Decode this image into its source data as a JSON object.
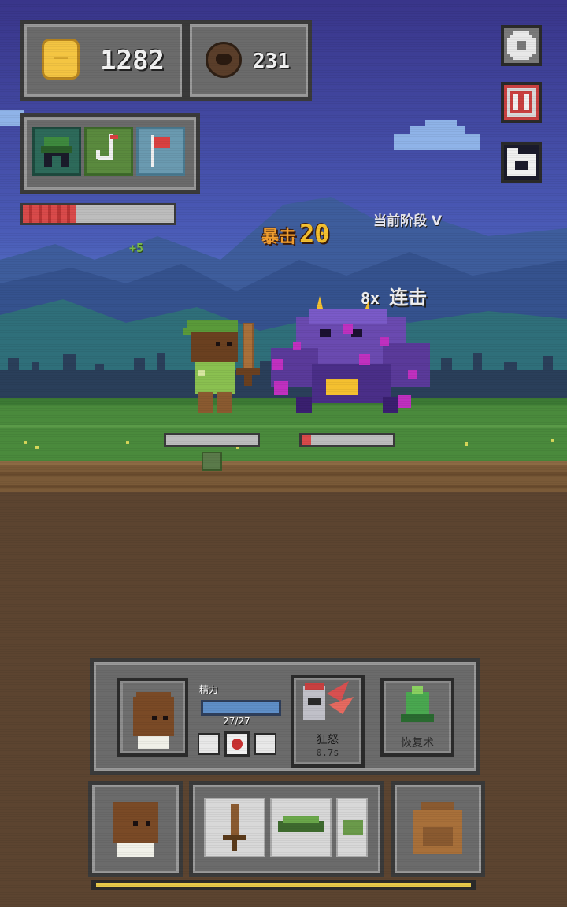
{
  "hud": {
    "gold": "1282",
    "gems": "231",
    "stage_label": "当前阶段 V",
    "plus_label": "+5"
  },
  "combat": {
    "crit_label": "暴击",
    "crit_value": "20",
    "combo_count": "8x",
    "combo_label": "连击",
    "player_hp_fraction": 0.0,
    "enemy_hp_fraction": 0.1,
    "player_main_hp_fraction": 0.35
  },
  "skills_panel": {
    "stamina_label": "精力",
    "stamina_value": "27/27",
    "rage_label": "狂怒",
    "rage_cooldown": "0.7s",
    "heal_label": "恢复术"
  },
  "colors": {
    "sky_top": "#3a3a8a",
    "sky_mid": "#4e6fc0",
    "grass": "#4a8a3c",
    "dirt": "#5a4430",
    "panel": "#6b6b6b",
    "red_bar": "#d94a4a",
    "gold": "#f4c542",
    "stamina_bar": "#5f8fc8",
    "xp_bar": "#e6c84a"
  },
  "icons": [
    "gold-coin-icon",
    "gem-icon",
    "settings-gear-icon",
    "pause-icon",
    "restart-icon",
    "helmet-icon",
    "fishing-hook-icon",
    "flag-icon",
    "sword-icon",
    "leaf-icon",
    "backpack-icon"
  ]
}
